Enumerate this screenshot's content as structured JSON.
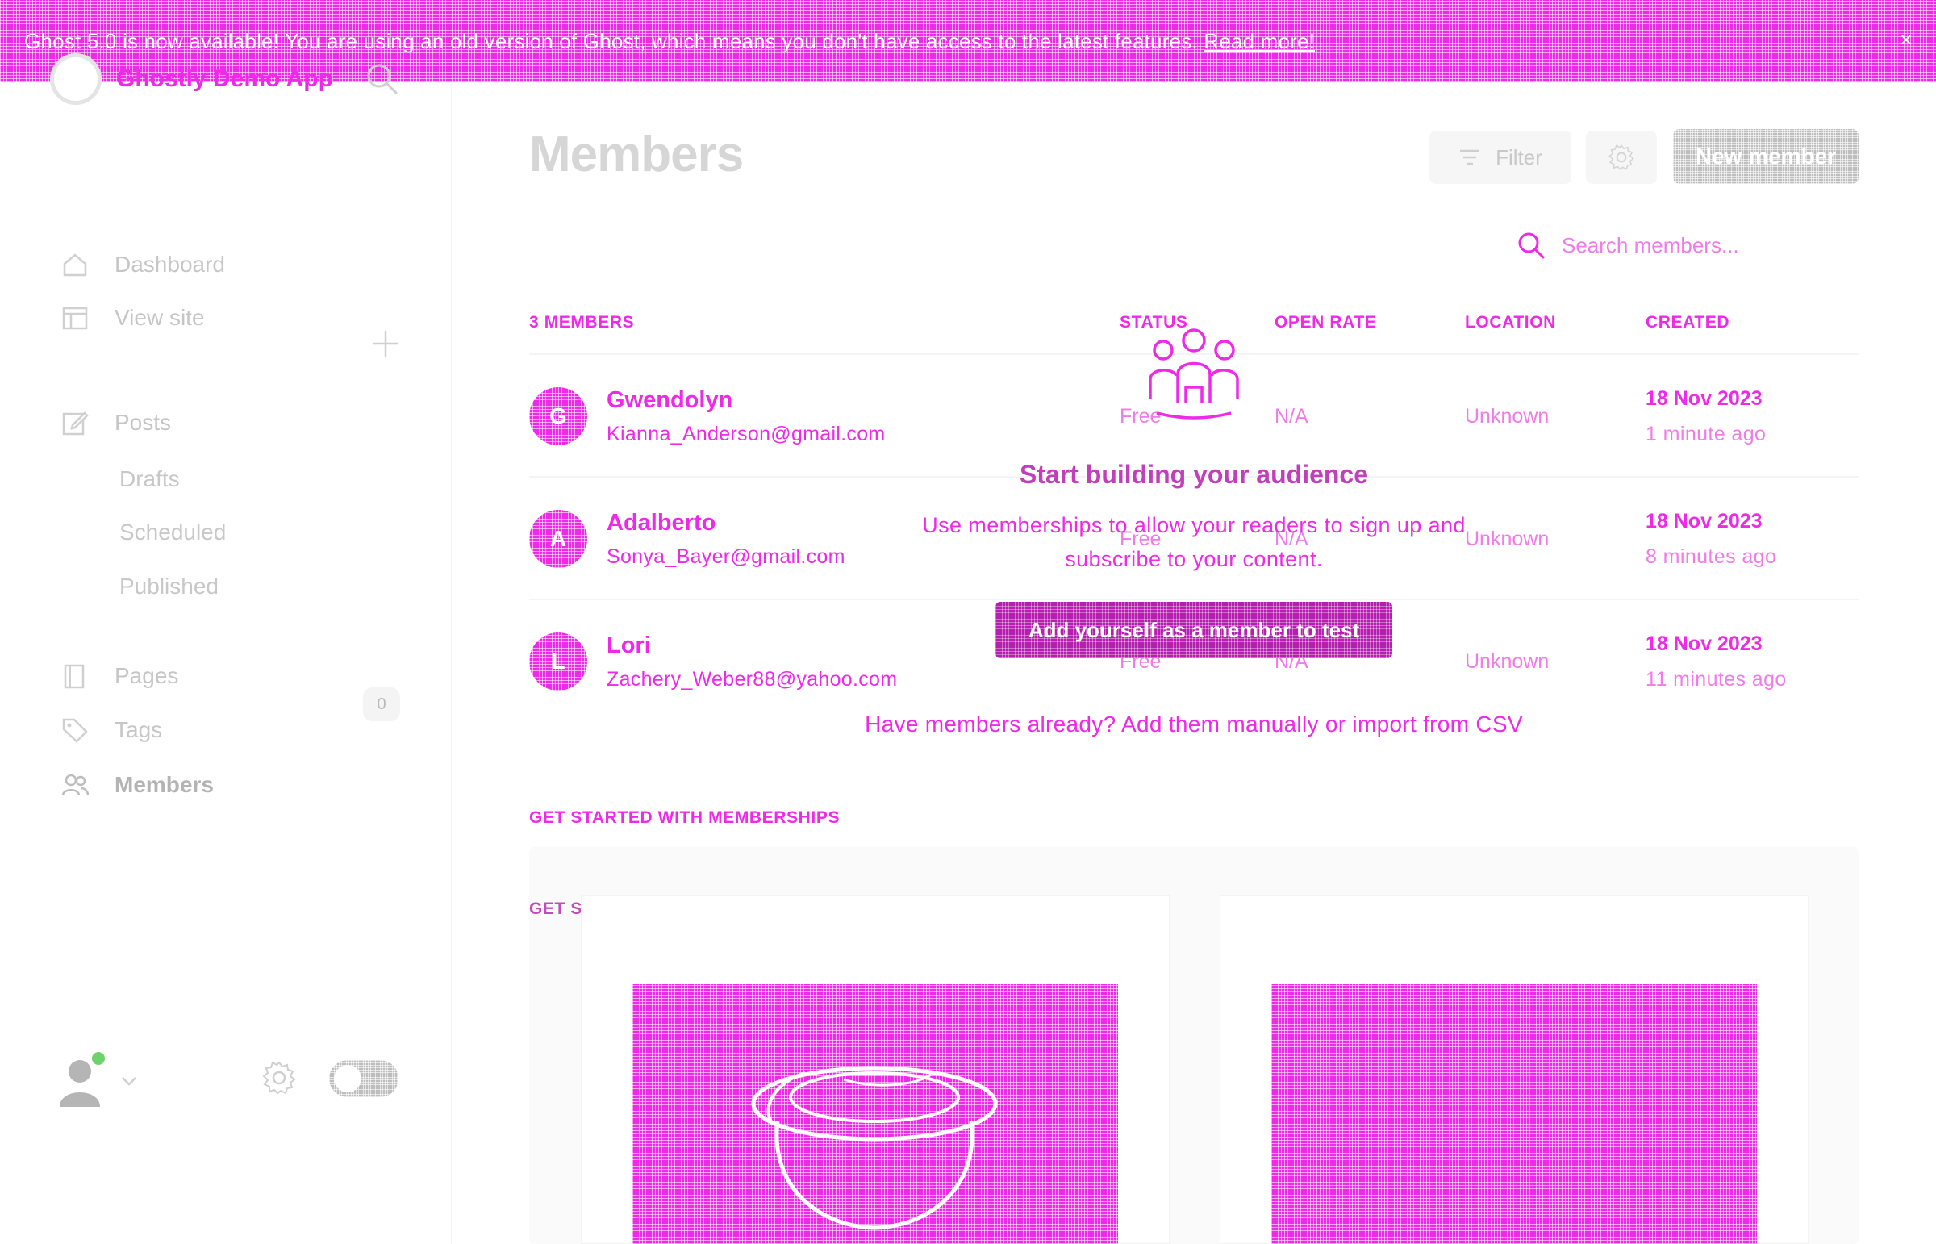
{
  "banner": {
    "text": "Ghost 5.0 is now available! You are using an old version of Ghost, which means you don't have access to the latest features.",
    "link": "Read more!",
    "close_glyph": "×"
  },
  "sidebar": {
    "brand_name": "Ghostly Demo App",
    "nav": [
      {
        "label": "Dashboard",
        "icon": "home-icon"
      },
      {
        "label": "View site",
        "icon": "site-icon"
      },
      {
        "label": "Posts",
        "icon": "pencil-icon"
      },
      {
        "label": "Pages",
        "icon": "page-icon"
      },
      {
        "label": "Tags",
        "icon": "tag-icon"
      },
      {
        "label": "Members",
        "icon": "members-icon"
      }
    ],
    "post_subitems": [
      "Drafts",
      "Scheduled",
      "Published"
    ],
    "members_count": "0"
  },
  "header": {
    "title": "Members",
    "filter_label": "Filter",
    "new_member_label": "New member",
    "search_placeholder": "Search members..."
  },
  "table": {
    "count_label": "3 MEMBERS",
    "columns": [
      "STATUS",
      "OPEN RATE",
      "LOCATION",
      "CREATED"
    ],
    "rows": [
      {
        "initial": "G",
        "name": "Gwendolyn",
        "email": "Kianna_Anderson@gmail.com",
        "status": "Free",
        "open_rate": "N/A",
        "location": "Unknown",
        "date": "18 Nov 2023",
        "ago": "1 minute ago"
      },
      {
        "initial": "A",
        "name": "Adalberto",
        "email": "Sonya_Bayer@gmail.com",
        "status": "Free",
        "open_rate": "N/A",
        "location": "Unknown",
        "date": "18 Nov 2023",
        "ago": "8 minutes ago"
      },
      {
        "initial": "L",
        "name": "Lori",
        "email": "Zachery_Weber88@yahoo.com",
        "status": "Free",
        "open_rate": "N/A",
        "location": "Unknown",
        "date": "18 Nov 2023",
        "ago": "11 minutes ago"
      }
    ]
  },
  "empty_state": {
    "title": "Start building your audience",
    "desc_line1": "Use memberships to allow your readers to sign up and",
    "desc_line2": "subscribe to your content.",
    "button": "Add yourself as a member to test",
    "footer": "Have members already? Add them manually or import from CSV"
  },
  "sections": {
    "get_started_1": "GET STARTED WITH MEMBERSHIPS",
    "get_started_2": "GET STARTED WITH MEMBERSHIPS"
  },
  "colors": {
    "accent": "#ee2ae8",
    "accent_dark": "#b61eaf",
    "muted": "#c6c6c6"
  }
}
